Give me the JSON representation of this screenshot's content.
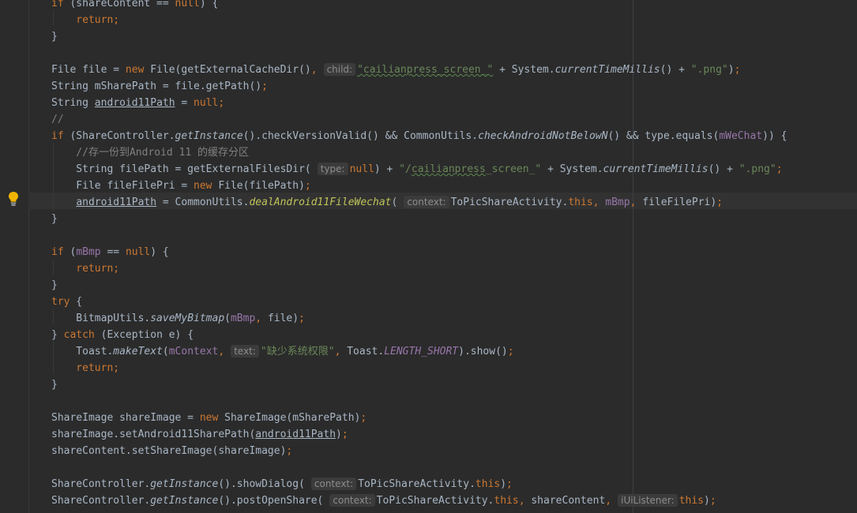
{
  "editor": {
    "intention_icon": "lightbulb-icon",
    "colors": {
      "background": "#2b2b2b",
      "keyword": "#cc7832",
      "string": "#6a8759",
      "field": "#9876aa",
      "comment": "#808080",
      "default": "#a9b7c6"
    },
    "lines": [
      {
        "tokens": [
          {
            "c": "kw",
            "v": "if"
          },
          {
            "c": "t",
            "v": " (shareContent == "
          },
          {
            "c": "kw",
            "v": "null"
          },
          {
            "c": "t",
            "v": ") {"
          }
        ]
      },
      {
        "tokens": [
          {
            "c": "kw",
            "v": "    return"
          },
          {
            "c": "kw",
            "v": ";"
          }
        ]
      },
      {
        "tokens": [
          {
            "c": "t",
            "v": "}"
          }
        ]
      },
      {
        "tokens": []
      },
      {
        "tokens": [
          {
            "c": "t",
            "v": "File file = "
          },
          {
            "c": "kw",
            "v": "new"
          },
          {
            "c": "t",
            "v": " File(getExternalCacheDir()"
          },
          {
            "c": "kw",
            "v": ","
          },
          {
            "c": "hint",
            "v": "child:"
          },
          {
            "c": "str squig",
            "v": "\"cailianpress_screen_\""
          },
          {
            "c": "t",
            "v": " + System."
          },
          {
            "c": "fnd",
            "v": "currentTimeMillis"
          },
          {
            "c": "t",
            "v": "() + "
          },
          {
            "c": "str",
            "v": "\".png\""
          },
          {
            "c": "t",
            "v": ")"
          },
          {
            "c": "kw",
            "v": ";"
          }
        ]
      },
      {
        "tokens": [
          {
            "c": "t",
            "v": "String mSharePath = file.getPath()"
          },
          {
            "c": "kw",
            "v": ";"
          }
        ]
      },
      {
        "tokens": [
          {
            "c": "t",
            "v": "String "
          },
          {
            "c": "t und",
            "v": "android11Path"
          },
          {
            "c": "t",
            "v": " = "
          },
          {
            "c": "kw",
            "v": "null;"
          }
        ]
      },
      {
        "tokens": [
          {
            "c": "cmt",
            "v": "//"
          }
        ]
      },
      {
        "tokens": [
          {
            "c": "kw",
            "v": "if"
          },
          {
            "c": "t",
            "v": " (ShareController."
          },
          {
            "c": "fnd",
            "v": "getInstance"
          },
          {
            "c": "t",
            "v": "().checkVersionValid() && CommonUtils."
          },
          {
            "c": "fnd",
            "v": "checkAndroidNotBelowN"
          },
          {
            "c": "t",
            "v": "() && type.equals("
          },
          {
            "c": "fld",
            "v": "mWeChat"
          },
          {
            "c": "t",
            "v": ")) {"
          }
        ]
      },
      {
        "tokens": [
          {
            "c": "cmt",
            "v": "    //存一份到Android 11 的缓存分区"
          }
        ]
      },
      {
        "tokens": [
          {
            "c": "t",
            "v": "    String filePath = getExternalFilesDir("
          },
          {
            "c": "hint",
            "v": "type:"
          },
          {
            "c": "kw",
            "v": "null"
          },
          {
            "c": "t",
            "v": ") + "
          },
          {
            "c": "str",
            "v": "\"/"
          },
          {
            "c": "str squig",
            "v": "cailianpress"
          },
          {
            "c": "str",
            "v": "_screen_\""
          },
          {
            "c": "t",
            "v": " + System."
          },
          {
            "c": "fnd",
            "v": "currentTimeMillis"
          },
          {
            "c": "t",
            "v": "() + "
          },
          {
            "c": "str",
            "v": "\".png\""
          },
          {
            "c": "kw",
            "v": ";"
          }
        ]
      },
      {
        "tokens": [
          {
            "c": "t",
            "v": "    File fileFilePri = "
          },
          {
            "c": "kw",
            "v": "new"
          },
          {
            "c": "t",
            "v": " File(filePath)"
          },
          {
            "c": "kw",
            "v": ";"
          }
        ]
      },
      {
        "tokens": [
          {
            "c": "t",
            "v": "    "
          },
          {
            "c": "t und",
            "v": "android11Path"
          },
          {
            "c": "t",
            "v": " = CommonUtils."
          },
          {
            "c": "warn",
            "v": "dealAndroid11FileWechat"
          },
          {
            "c": "t",
            "v": "("
          },
          {
            "c": "hint",
            "v": "context:"
          },
          {
            "c": "t",
            "v": "ToPicShareActivity."
          },
          {
            "c": "kw",
            "v": "this,"
          },
          {
            "c": "t",
            "v": " "
          },
          {
            "c": "fld",
            "v": "mBmp"
          },
          {
            "c": "kw",
            "v": ","
          },
          {
            "c": "t",
            "v": " fileFilePri)"
          },
          {
            "c": "kw",
            "v": ";"
          }
        ]
      },
      {
        "tokens": [
          {
            "c": "t",
            "v": "}"
          }
        ]
      },
      {
        "tokens": []
      },
      {
        "tokens": [
          {
            "c": "kw",
            "v": "if"
          },
          {
            "c": "t",
            "v": " ("
          },
          {
            "c": "fld",
            "v": "mBmp"
          },
          {
            "c": "t",
            "v": " == "
          },
          {
            "c": "kw",
            "v": "null"
          },
          {
            "c": "t",
            "v": ") {"
          }
        ]
      },
      {
        "tokens": [
          {
            "c": "kw",
            "v": "    return;"
          }
        ]
      },
      {
        "tokens": [
          {
            "c": "t",
            "v": "}"
          }
        ]
      },
      {
        "tokens": [
          {
            "c": "kw",
            "v": "try"
          },
          {
            "c": "t",
            "v": " {"
          }
        ]
      },
      {
        "tokens": [
          {
            "c": "t",
            "v": "    BitmapUtils."
          },
          {
            "c": "fnd",
            "v": "saveMyBitmap"
          },
          {
            "c": "t",
            "v": "("
          },
          {
            "c": "fld",
            "v": "mBmp"
          },
          {
            "c": "kw",
            "v": ","
          },
          {
            "c": "t",
            "v": " file)"
          },
          {
            "c": "kw",
            "v": ";"
          }
        ]
      },
      {
        "tokens": [
          {
            "c": "t",
            "v": "} "
          },
          {
            "c": "kw",
            "v": "catch"
          },
          {
            "c": "t",
            "v": " (Exception e) {"
          }
        ]
      },
      {
        "tokens": [
          {
            "c": "t",
            "v": "    Toast."
          },
          {
            "c": "fnd",
            "v": "makeText"
          },
          {
            "c": "t",
            "v": "("
          },
          {
            "c": "fld",
            "v": "mContext"
          },
          {
            "c": "kw",
            "v": ","
          },
          {
            "c": "hint",
            "v": "text:"
          },
          {
            "c": "str",
            "v": "\"缺少系统权限\""
          },
          {
            "c": "kw",
            "v": ","
          },
          {
            "c": "t",
            "v": " Toast."
          },
          {
            "c": "fld ital",
            "v": "LENGTH_SHORT"
          },
          {
            "c": "t",
            "v": ").show()"
          },
          {
            "c": "kw",
            "v": ";"
          }
        ]
      },
      {
        "tokens": [
          {
            "c": "kw",
            "v": "    return;"
          }
        ]
      },
      {
        "tokens": [
          {
            "c": "t",
            "v": "}"
          }
        ]
      },
      {
        "tokens": []
      },
      {
        "tokens": [
          {
            "c": "t",
            "v": "ShareImage shareImage = "
          },
          {
            "c": "kw",
            "v": "new"
          },
          {
            "c": "t",
            "v": " ShareImage(mSharePath)"
          },
          {
            "c": "kw",
            "v": ";"
          }
        ]
      },
      {
        "tokens": [
          {
            "c": "t",
            "v": "shareImage.setAndroid11SharePath("
          },
          {
            "c": "t und",
            "v": "android11Path"
          },
          {
            "c": "t",
            "v": ")"
          },
          {
            "c": "kw",
            "v": ";"
          }
        ]
      },
      {
        "tokens": [
          {
            "c": "t",
            "v": "shareContent.setShareImage(shareImage)"
          },
          {
            "c": "kw",
            "v": ";"
          }
        ]
      },
      {
        "tokens": []
      },
      {
        "tokens": [
          {
            "c": "t",
            "v": "ShareController."
          },
          {
            "c": "fnd",
            "v": "getInstance"
          },
          {
            "c": "t",
            "v": "().showDialog("
          },
          {
            "c": "hint",
            "v": "context:"
          },
          {
            "c": "t",
            "v": "ToPicShareActivity."
          },
          {
            "c": "kw",
            "v": "this"
          },
          {
            "c": "t",
            "v": ")"
          },
          {
            "c": "kw",
            "v": ";"
          }
        ]
      },
      {
        "tokens": [
          {
            "c": "t",
            "v": "ShareController."
          },
          {
            "c": "fnd",
            "v": "getInstance"
          },
          {
            "c": "t",
            "v": "().postOpenShare("
          },
          {
            "c": "hint",
            "v": "context:"
          },
          {
            "c": "t",
            "v": "ToPicShareActivity."
          },
          {
            "c": "kw",
            "v": "this,"
          },
          {
            "c": "t",
            "v": " shareContent"
          },
          {
            "c": "kw",
            "v": ","
          },
          {
            "c": "hint",
            "v": "iUiListener:"
          },
          {
            "c": "kw",
            "v": "this"
          },
          {
            "c": "t",
            "v": ")"
          },
          {
            "c": "kw",
            "v": ";"
          }
        ]
      }
    ]
  }
}
